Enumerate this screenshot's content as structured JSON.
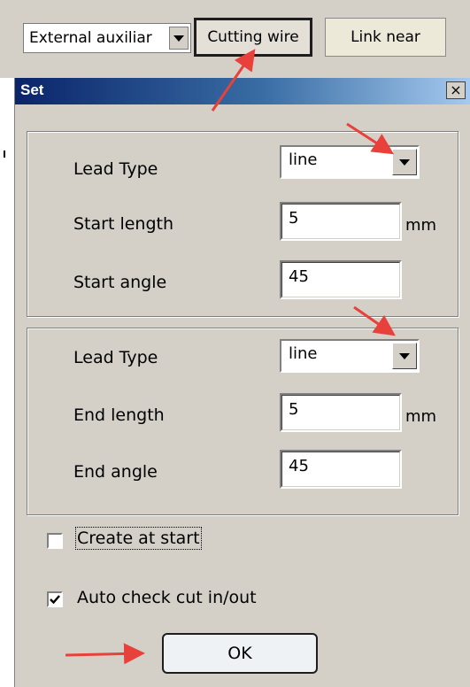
{
  "toolbar": {
    "combo_value": "External auxiliar",
    "cutting_wire_label": "Cutting wire",
    "link_near_label": "Link near"
  },
  "dialog": {
    "title": "Set",
    "close_glyph": "×"
  },
  "start_group": {
    "lead_type_label": "Lead Type",
    "lead_type_value": "line",
    "length_label": "Start length",
    "length_value": "5",
    "length_unit": "mm",
    "angle_label": "Start angle",
    "angle_value": "45"
  },
  "end_group": {
    "lead_type_label": "Lead Type",
    "lead_type_value": "line",
    "length_label": "End length",
    "length_value": "5",
    "length_unit": "mm",
    "angle_label": "End angle",
    "angle_value": "45"
  },
  "options": {
    "create_at_start_label": "Create at start",
    "create_at_start_checked": false,
    "auto_check_label": "Auto check cut in/out",
    "auto_check_checked": true
  },
  "ok_label": "OK",
  "annotation_color": "#e8403a"
}
